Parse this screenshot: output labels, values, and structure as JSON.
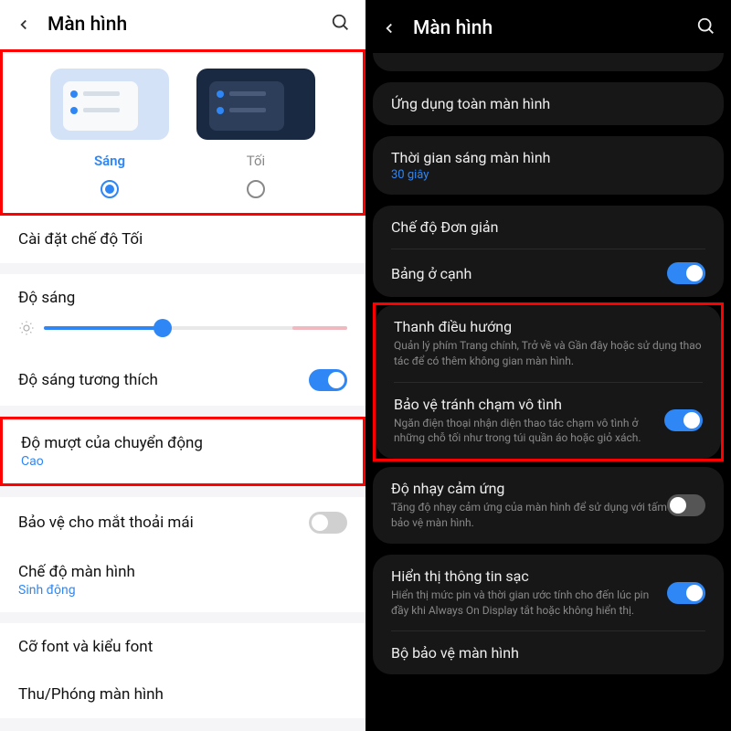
{
  "left": {
    "header_title": "Màn hình",
    "theme_light_label": "Sáng",
    "theme_dark_label": "Tối",
    "dark_mode_settings": "Cài đặt chế độ Tối",
    "brightness_label": "Độ sáng",
    "adaptive_brightness": "Độ sáng tương thích",
    "motion_smoothness": "Độ mượt của chuyển động",
    "motion_value": "Cao",
    "eye_comfort": "Bảo vệ cho mắt thoải mái",
    "screen_mode": "Chế độ màn hình",
    "screen_mode_value": "Sinh động",
    "font_size": "Cỡ font và kiểu font",
    "zoom": "Thu/Phóng màn hình"
  },
  "right": {
    "header_title": "Màn hình",
    "fullscreen_apps": "Ứng dụng toàn màn hình",
    "screen_timeout": "Thời gian sáng màn hình",
    "screen_timeout_value": "30 giây",
    "easy_mode": "Chế độ Đơn giản",
    "edge_panels": "Bảng ở cạnh",
    "nav_bar": "Thanh điều hướng",
    "nav_bar_desc": "Quản lý phím Trang chính, Trở về và Gần đây hoặc sử dụng thao tác để có thêm không gian màn hình.",
    "accidental_touch": "Bảo vệ tránh chạm vô tình",
    "accidental_touch_desc": "Ngăn điện thoại nhận diện thao tác chạm vô tình ở những chỗ tối như trong túi quần áo hoặc giỏ xách.",
    "touch_sensitivity": "Độ nhạy cảm ứng",
    "touch_sensitivity_desc": "Tăng độ nhạy cảm ứng của màn hình để sử dụng với tấm bảo vệ màn hình.",
    "charging_info": "Hiển thị thông tin sạc",
    "charging_info_desc": "Hiển thị mức pin và thời gian ước tính cho đến lúc pin đầy khi Always On Display tắt hoặc không hiển thị.",
    "screen_saver": "Bộ bảo vệ màn hình"
  }
}
